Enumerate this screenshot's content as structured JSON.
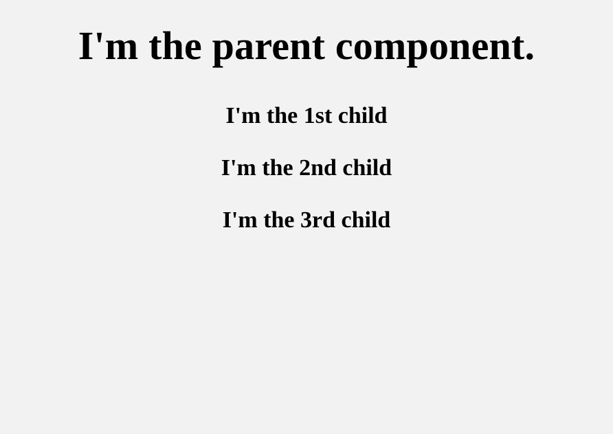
{
  "parent": {
    "title": "I'm the parent component."
  },
  "children": [
    {
      "label": "I'm the 1st child"
    },
    {
      "label": "I'm the 2nd child"
    },
    {
      "label": "I'm the 3rd child"
    }
  ],
  "colors": {
    "background": "#f2f2f2",
    "text": "#000000"
  }
}
